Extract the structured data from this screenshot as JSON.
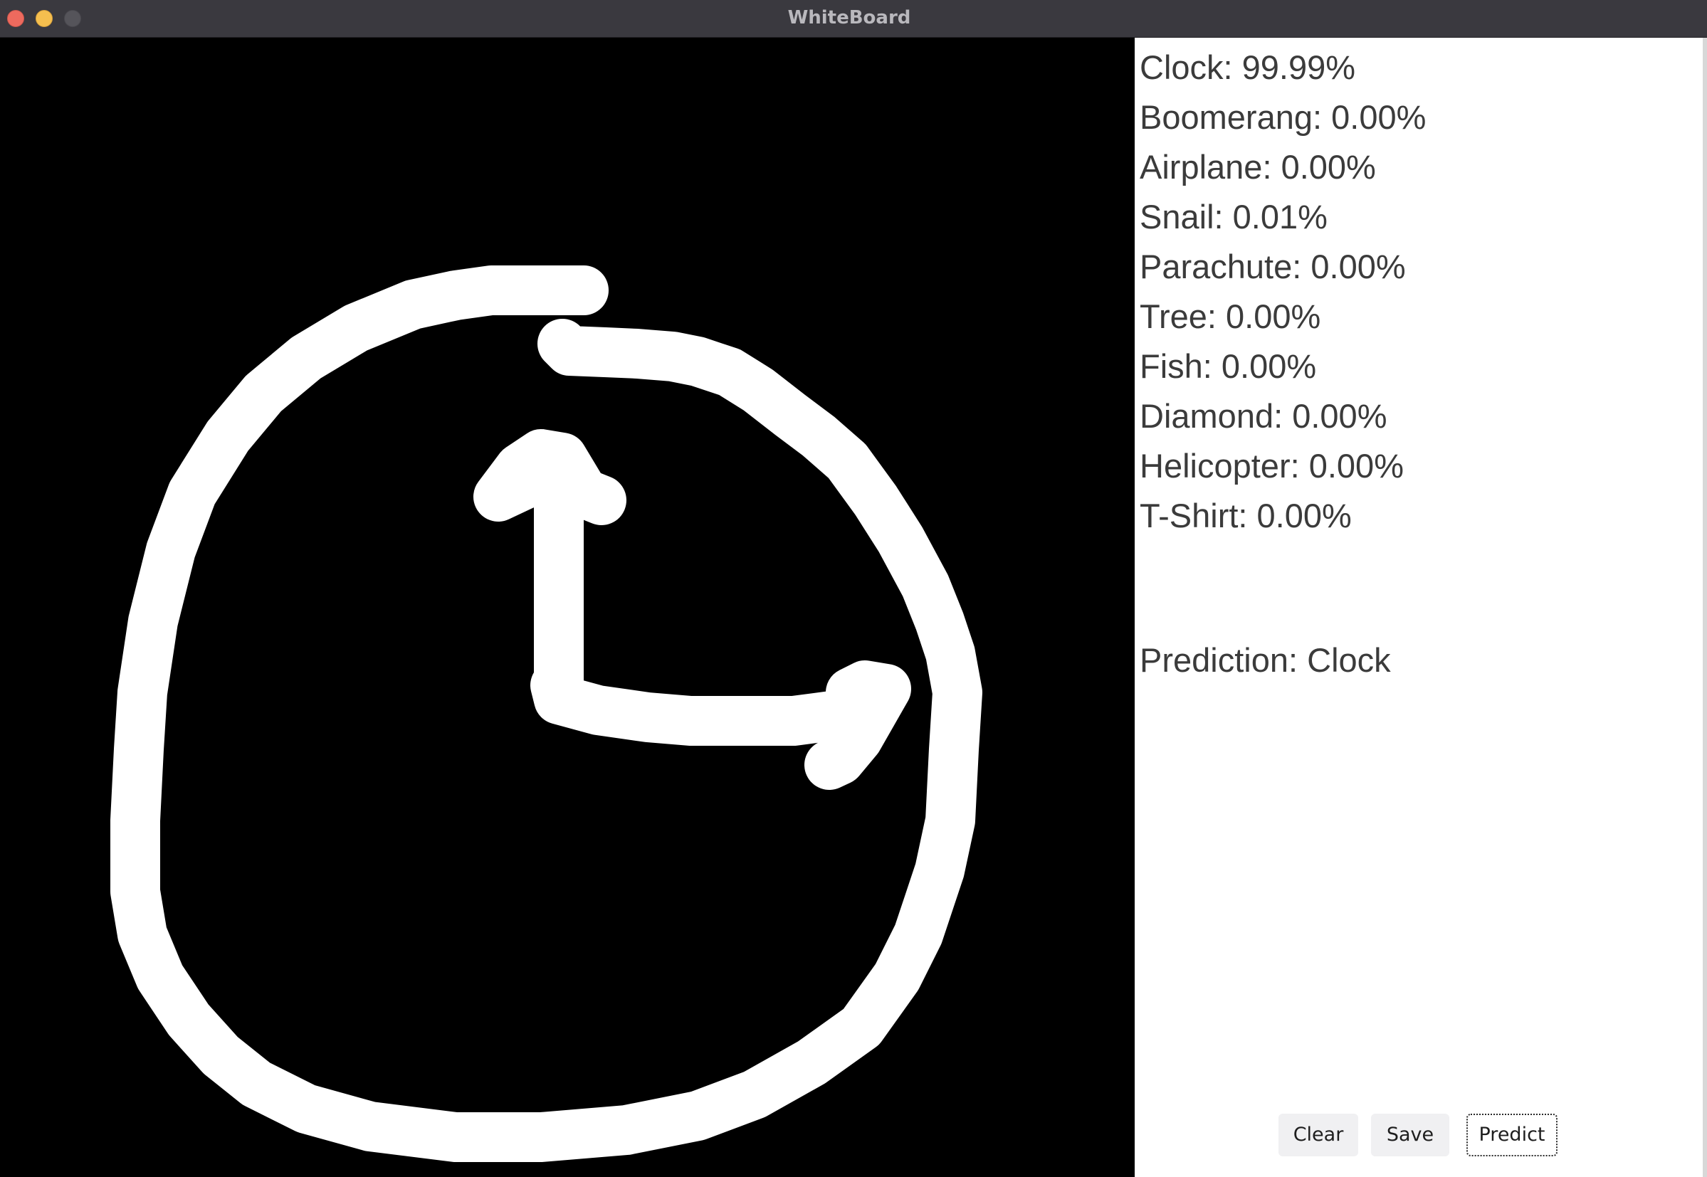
{
  "window": {
    "title": "WhiteBoard"
  },
  "probabilities": [
    {
      "label": "Clock",
      "value": "99.99%"
    },
    {
      "label": "Boomerang",
      "value": "0.00%"
    },
    {
      "label": "Airplane",
      "value": "0.00%"
    },
    {
      "label": "Snail",
      "value": "0.01%"
    },
    {
      "label": "Parachute",
      "value": "0.00%"
    },
    {
      "label": "Tree",
      "value": "0.00%"
    },
    {
      "label": "Fish",
      "value": "0.00%"
    },
    {
      "label": "Diamond",
      "value": "0.00%"
    },
    {
      "label": "Helicopter",
      "value": "0.00%"
    },
    {
      "label": "T-Shirt",
      "value": "0.00%"
    }
  ],
  "prediction": {
    "label": "Prediction",
    "value": "Clock"
  },
  "buttons": {
    "clear": "Clear",
    "save": "Save",
    "predict": "Predict"
  },
  "colors": {
    "canvas_background": "#000000",
    "stroke": "#ffffff",
    "panel_background": "#ffffff",
    "text": "#3b3b3b"
  }
}
